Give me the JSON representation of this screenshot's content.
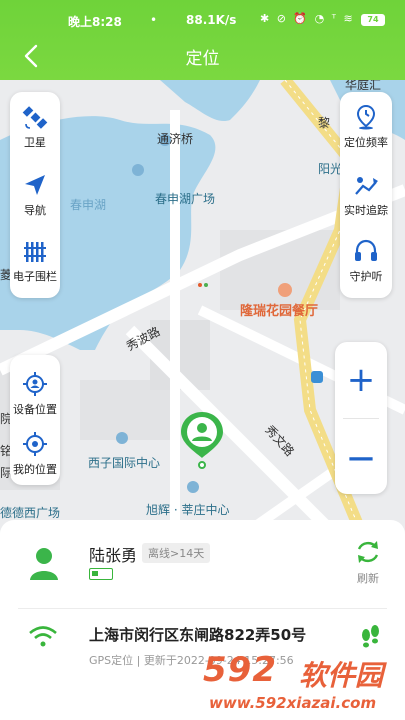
{
  "status_bar": {
    "time": "晚上8:28",
    "dot": "•",
    "speed": "88.1K/s",
    "icons": "✱ ⊘ ⏰ ◔ ᵀ ≋",
    "battery": "74"
  },
  "header": {
    "title": "定位"
  },
  "map": {
    "labels": {
      "tongji_bridge": "通济桥",
      "chunshen_lake": "春申湖",
      "chunshen_plaza": "春申湖广场",
      "longrui": "隆瑞花园餐厅",
      "xiubo_road": "秀波路",
      "xiuwen_road": "秀文路",
      "xizi": "西子国际中心",
      "xuhui": "旭辉 · 莘庄中心",
      "dede": "德德西广场",
      "yangguang": "阳光",
      "li": "黎",
      "huating": "华庭汇",
      "left_edge_1": "院",
      "left_edge_2": "铭",
      "left_edge_3": "际",
      "left_edge_4": "菱"
    },
    "left_panel": [
      {
        "label": "卫星",
        "icon": "satellite-icon"
      },
      {
        "label": "导航",
        "icon": "navigation-icon"
      },
      {
        "label": "电子围栏",
        "icon": "fence-icon"
      }
    ],
    "left_panel2": [
      {
        "label": "设备位置",
        "icon": "device-location-icon"
      },
      {
        "label": "我的位置",
        "icon": "my-location-icon"
      }
    ],
    "right_panel": [
      {
        "label": "定位频率",
        "icon": "location-frequency-icon"
      },
      {
        "label": "实时追踪",
        "icon": "realtime-tracking-icon"
      },
      {
        "label": "守护听",
        "icon": "headphones-icon"
      }
    ],
    "zoom": {
      "in": "+",
      "out": "—"
    }
  },
  "card": {
    "name": "陆张勇",
    "status_badge": "离线>14天",
    "refresh_label": "刷新",
    "address": "上海市闵行区东闸路822弄50号",
    "meta": "GPS定位 | 更新于2022-09-24 15:27:56"
  },
  "watermark": {
    "number": "592",
    "text": "软件园",
    "url": "www.592xiazai.com"
  },
  "colors": {
    "brand_green": "#6fd33a",
    "accent_blue": "#1f63c9",
    "pin_green": "#3bb54a"
  }
}
